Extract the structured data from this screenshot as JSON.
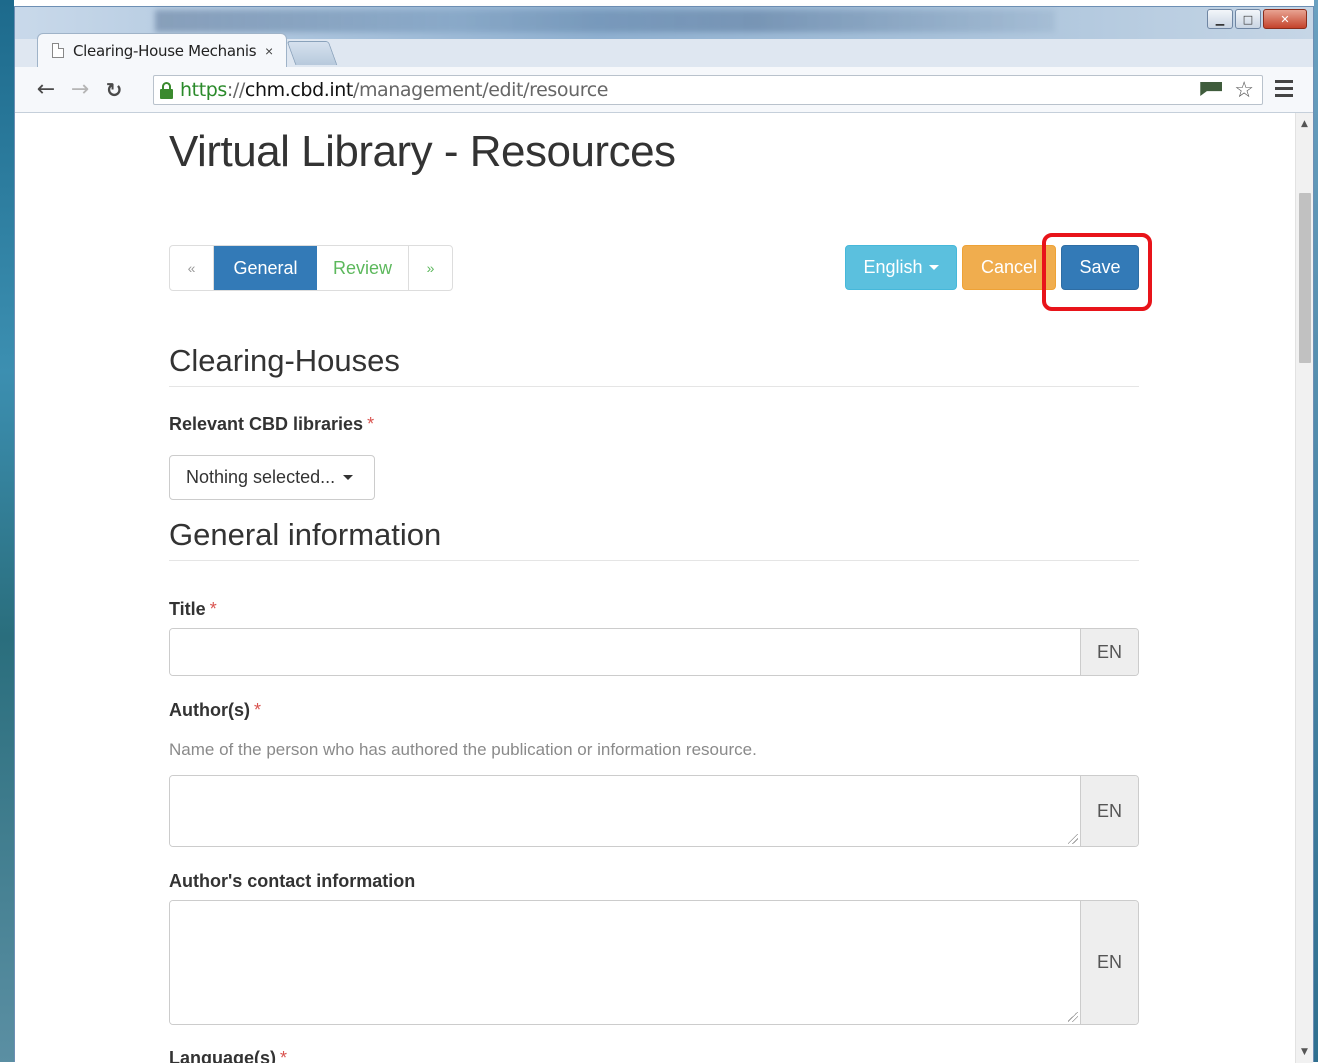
{
  "browser": {
    "tab_title": "Clearing-House Mechanis",
    "tab_close": "×",
    "url": {
      "scheme": "https",
      "separator": "://",
      "host": "chm.cbd.int",
      "path": "/management/edit/resource"
    },
    "icons": {
      "back": "back-arrow-icon",
      "forward": "forward-arrow-icon",
      "reload": "reload-icon",
      "lock": "lock-icon",
      "bookmark": "star-icon",
      "extension": "flag-icon",
      "menu": "hamburger-menu-icon"
    }
  },
  "page": {
    "title": "Virtual Library - Resources",
    "pager": {
      "prev": "«",
      "general": "General",
      "review": "Review",
      "next": "»"
    },
    "buttons": {
      "language": "English",
      "cancel": "Cancel",
      "save": "Save"
    },
    "sections": {
      "clearing_houses": "Clearing-Houses",
      "general_information": "General information"
    },
    "fields": {
      "libraries_label": "Relevant CBD libraries",
      "libraries_value": "Nothing selected...",
      "title_label": "Title",
      "title_value": "",
      "title_lang": "EN",
      "authors_label": "Author(s)",
      "authors_help": "Name of the person who has authored the publication or information resource.",
      "authors_value": "",
      "authors_lang": "EN",
      "contact_label": "Author's contact information",
      "contact_value": "",
      "contact_lang": "EN",
      "languages_label": "Language(s)",
      "required_mark": "*"
    }
  },
  "colors": {
    "primary": "#337ab7",
    "info": "#5bc0de",
    "warning": "#f0ad4e",
    "success": "#5cb85c",
    "required": "#d9534f",
    "highlight": "#e8141a"
  }
}
